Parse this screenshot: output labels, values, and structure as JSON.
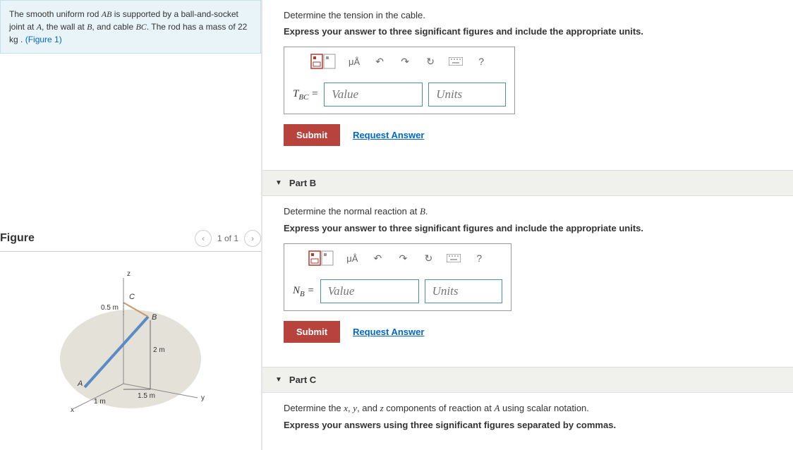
{
  "problem": {
    "text_pre": "The smooth uniform rod ",
    "rod": "AB",
    "text_mid1": " is supported by a ball-and-socket joint at ",
    "A": "A",
    "text_mid2": ", the wall at ",
    "B": "B",
    "text_mid3": ", and cable ",
    "BC": "BC",
    "text_mid4": ". The rod has a mass of 22 ",
    "unit": "kg",
    "text_end": " . ",
    "figlink": "(Figure 1)"
  },
  "figure": {
    "title": "Figure",
    "counter": "1 of 1",
    "labels": {
      "z": "z",
      "C": "C",
      "half": "0.5 m",
      "B": "B",
      "two": "2 m",
      "A": "A",
      "onefive": "1.5 m",
      "one": "1 m",
      "x": "x",
      "y": "y"
    }
  },
  "partA": {
    "prompt": "Determine the tension in the cable.",
    "hint": "Express your answer to three significant figures and include the appropriate units.",
    "var_pre": "T",
    "var_sub": "BC",
    "eq": " = ",
    "value_ph": "Value",
    "units_ph": "Units",
    "submit": "Submit",
    "request": "Request Answer",
    "mu": "μÅ",
    "help": "?"
  },
  "partB": {
    "header": "Part B",
    "prompt_pre": "Determine the normal reaction at ",
    "prompt_B": "B",
    "prompt_post": ".",
    "hint": "Express your answer to three significant figures and include the appropriate units.",
    "var_pre": "N",
    "var_sub": "B",
    "eq": " = ",
    "value_ph": "Value",
    "units_ph": "Units",
    "submit": "Submit",
    "request": "Request Answer",
    "mu": "μÅ",
    "help": "?"
  },
  "partC": {
    "header": "Part C",
    "prompt_pre": "Determine the ",
    "x": "x",
    "c1": ", ",
    "y": "y",
    "c2": ", and ",
    "z": "z",
    "prompt_mid": " components of reaction at ",
    "A": "A",
    "prompt_post": " using scalar notation.",
    "hint": "Express your answers using three significant figures separated by commas."
  }
}
